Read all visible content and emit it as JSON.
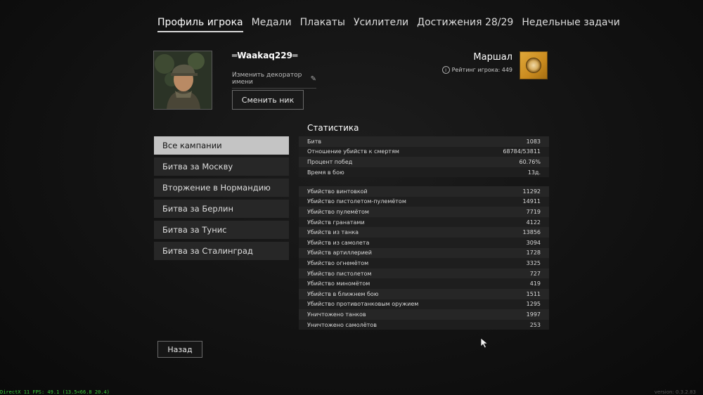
{
  "tabs": [
    {
      "label": "Профиль игрока",
      "active": true
    },
    {
      "label": "Медали",
      "active": false
    },
    {
      "label": "Плакаты",
      "active": false
    },
    {
      "label": "Усилители",
      "active": false
    },
    {
      "label": "Достижения 28/29",
      "active": false
    },
    {
      "label": "Недельные задачи",
      "active": false
    }
  ],
  "profile": {
    "nickname": "═Waakaq229═",
    "change_decorator": "Изменить декоратор имени",
    "change_nick": "Сменить ник",
    "rank": "Маршал",
    "rating": "Рейтинг игрока: 449"
  },
  "campaigns": [
    {
      "label": "Все кампании",
      "active": true
    },
    {
      "label": "Битва за Москву",
      "active": false
    },
    {
      "label": "Вторжение в Нормандию",
      "active": false
    },
    {
      "label": "Битва за Берлин",
      "active": false
    },
    {
      "label": "Битва за Тунис",
      "active": false
    },
    {
      "label": "Битва за Сталинград",
      "active": false
    }
  ],
  "stats": {
    "title": "Статистика",
    "general": [
      {
        "label": "Битв",
        "value": "1083"
      },
      {
        "label": "Отношение убийств к смертям",
        "value": "68784/53811"
      },
      {
        "label": "Процент побед",
        "value": "60.76%"
      },
      {
        "label": "Время в бою",
        "value": "13д."
      }
    ],
    "kills": [
      {
        "label": "Убийство винтовкой",
        "value": "11292"
      },
      {
        "label": "Убийство пистолетом-пулемётом",
        "value": "14911"
      },
      {
        "label": "Убийство пулемётом",
        "value": "7719"
      },
      {
        "label": "Убийств гранатами",
        "value": "4122"
      },
      {
        "label": "Убийств из танка",
        "value": "13856"
      },
      {
        "label": "Убийств из самолета",
        "value": "3094"
      },
      {
        "label": "Убийств артиллерией",
        "value": "1728"
      },
      {
        "label": "Убийство огнемётом",
        "value": "3325"
      },
      {
        "label": "Убийство пистолетом",
        "value": "727"
      },
      {
        "label": "Убийство миномётом",
        "value": "419"
      },
      {
        "label": "Убийств в ближнем бою",
        "value": "1511"
      },
      {
        "label": "Убийство противотанковым оружием",
        "value": "1295"
      },
      {
        "label": "Уничтожено танков",
        "value": "1997"
      },
      {
        "label": "Уничтожено самолётов",
        "value": "253"
      }
    ]
  },
  "back_label": "Назад",
  "fps": "DirectX 11 FPS: 49.1 (13.5<66.8 20.4)",
  "version": "version: 0.3.2.83",
  "colors": {
    "accent_badge": "#d49a2c",
    "active_campaign_bg": "#c4c4c4",
    "fps_text": "#3bcc3b"
  }
}
